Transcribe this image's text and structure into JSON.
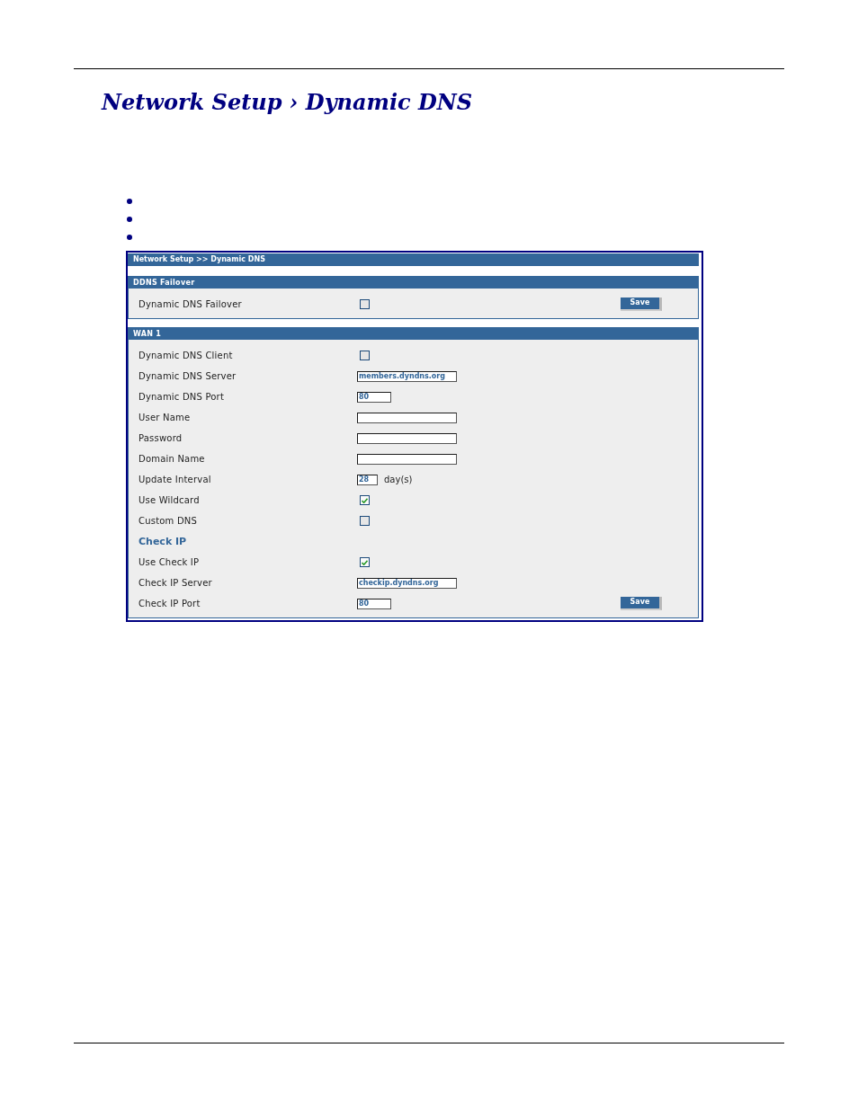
{
  "document": {
    "title": "Network Setup › Dynamic DNS",
    "bullets": [
      {
        "kind": "dot"
      },
      {
        "kind": "dot"
      },
      {
        "kind": "dot"
      }
    ]
  },
  "screenshot": {
    "breadcrumb": "Network Setup >> Dynamic DNS",
    "sections": [
      {
        "title": "DDNS Failover",
        "rows": [
          {
            "kind": "checkbox",
            "label": "Dynamic DNS Failover",
            "checked": false,
            "button": "Save"
          }
        ]
      },
      {
        "title": "WAN 1",
        "rows": [
          {
            "kind": "checkbox",
            "label": "Dynamic DNS Client",
            "checked": false
          },
          {
            "kind": "textbox",
            "label": "Dynamic DNS Server",
            "value": "members.dyndns.org"
          },
          {
            "kind": "portbox",
            "label": "Dynamic DNS Port",
            "value": "80"
          },
          {
            "kind": "textbox",
            "label": "User Name"
          },
          {
            "kind": "textbox",
            "label": "Password"
          },
          {
            "kind": "textbox",
            "label": "Domain Name"
          },
          {
            "kind": "daybox",
            "label": "Update Interval",
            "value": "28",
            "unit": "day(s)"
          },
          {
            "kind": "checkbox",
            "label": "Use Wildcard",
            "checked": true
          },
          {
            "kind": "checkbox",
            "label": "Custom DNS",
            "checked": false
          },
          {
            "kind": "heading",
            "label": "Check IP"
          },
          {
            "kind": "checkbox",
            "label": "Use Check IP",
            "checked": true
          },
          {
            "kind": "textbox",
            "label": "Check IP Server",
            "value": "checkip.dyndns.org"
          },
          {
            "kind": "portbox",
            "label": "Check IP Port",
            "value": "80",
            "button": "Save"
          }
        ]
      }
    ]
  }
}
